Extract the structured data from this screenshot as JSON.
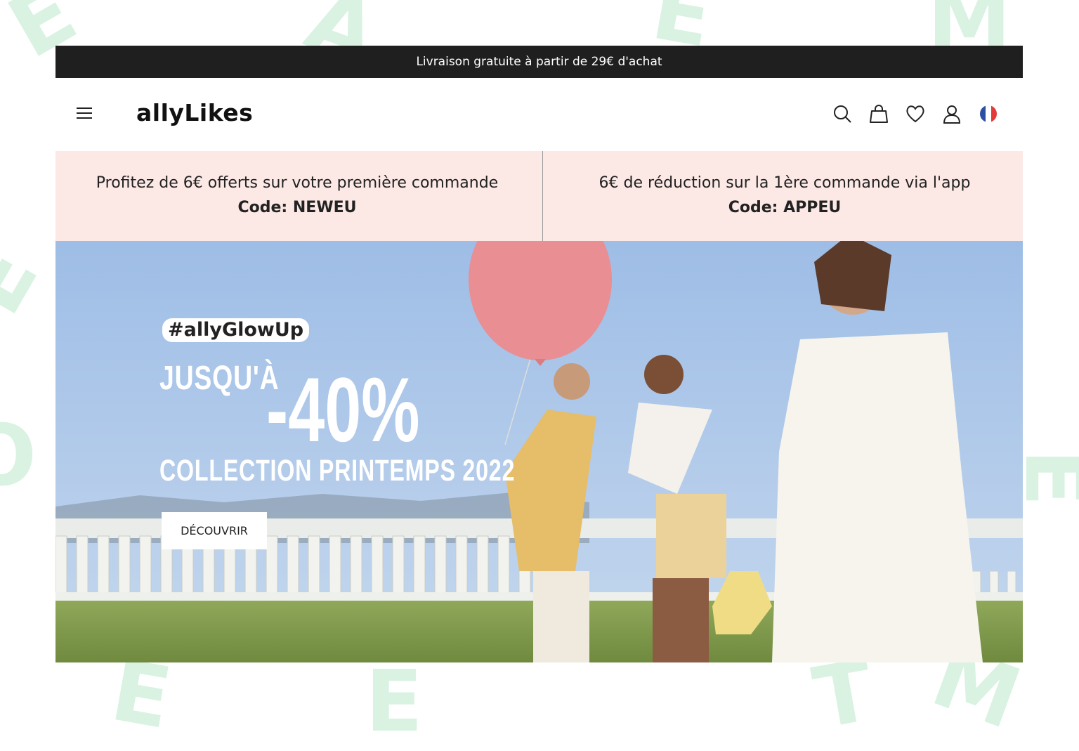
{
  "topbar": {
    "text": "Livraison gratuite à partir de 29€ d'achat"
  },
  "header": {
    "logo": "allyLikes",
    "icons": [
      "menu-icon",
      "search-icon",
      "bag-icon",
      "heart-icon",
      "user-icon",
      "france-flag-icon"
    ]
  },
  "promo": {
    "left": {
      "line1": "Profitez de 6€ offerts  sur votre première commande",
      "line2": "Code: NEWEU"
    },
    "right": {
      "line1": "6€ de réduction sur la 1ère commande via l'app",
      "line2": "Code: APPEU"
    }
  },
  "hero": {
    "hashtag": "#allyGlowUp",
    "prefix": "JUSQU'À",
    "discount": "-40%",
    "collection": "COLLECTION PRINTEMPS 2022",
    "cta": "DÉCOUVRIR"
  },
  "colors": {
    "topbar_bg": "#1f1f1f",
    "promo_bg": "#fce9e6",
    "sky": "#a9c6e8",
    "grass": "#7f9a4a",
    "background_letters": "#d9f2e2"
  }
}
